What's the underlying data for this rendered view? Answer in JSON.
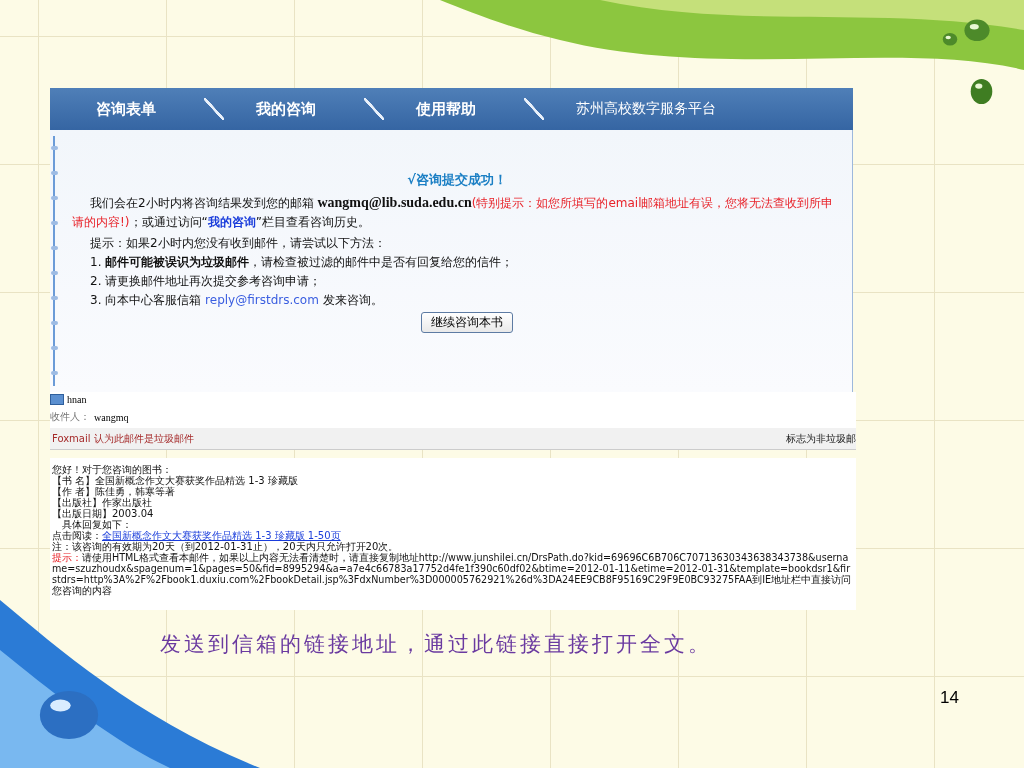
{
  "nav": {
    "items": [
      {
        "label": "咨询表单"
      },
      {
        "label": "我的咨询"
      },
      {
        "label": "使用帮助"
      }
    ],
    "platform": "苏州高校数字服务平台"
  },
  "result": {
    "title": "√咨询提交成功！",
    "notice": [
      {
        "kind": "text",
        "text": "我们会在2小时内将咨询结果发到您的邮箱 "
      },
      {
        "kind": "email",
        "text": "wangmq@lib.suda.edu.cn"
      },
      {
        "kind": "warning",
        "text": "(特别提示：如您所填写的email邮箱地址有误，您将无法查收到所申请的内容!)"
      },
      {
        "kind": "text",
        "text": "；或通过访问“"
      },
      {
        "kind": "link",
        "text": "我的咨询"
      },
      {
        "kind": "text",
        "text": "”栏目查看咨询历史。"
      }
    ],
    "hint": "提示：如果2小时内您没有收到邮件，请尝试以下方法：",
    "steps": [
      [
        {
          "kind": "text",
          "text": "1. "
        },
        {
          "kind": "bold",
          "text": "邮件可能被误识为垃圾邮件"
        },
        {
          "kind": "text",
          "text": "，请检查被过滤的邮件中是否有回复给您的信件；"
        }
      ],
      [
        {
          "kind": "text",
          "text": "2. 请更换邮件地址再次提交参考咨询申请；"
        }
      ],
      [
        {
          "kind": "text",
          "text": "3. 向本中心客服信箱 "
        },
        {
          "kind": "mail",
          "text": "reply@firstdrs.com"
        },
        {
          "kind": "text",
          "text": " 发来咨询。"
        }
      ]
    ],
    "button": "继续咨询本书"
  },
  "email": {
    "sender": "hnan",
    "recipient_label": "收件人：",
    "recipient": "wangmq",
    "spam_notice": "Foxmail 认为此邮件是垃圾邮件",
    "spam_action": "标志为非垃圾邮",
    "body": [
      {
        "kind": "text",
        "text": "您好！对于您咨询的图书："
      },
      {
        "kind": "text",
        "text": "【书 名】全国新概念作文大赛获奖作品精选 1-3 珍藏版"
      },
      {
        "kind": "text",
        "text": "【作 者】陈佳勇，韩寒等著"
      },
      {
        "kind": "text",
        "text": "【出版社】作家出版社"
      },
      {
        "kind": "text",
        "text": "【出版日期】2003.04"
      },
      {
        "kind": "indent",
        "text": "具体回复如下："
      },
      {
        "kind": "link",
        "label": "点击阅读：",
        "text": "全国新概念作文大赛获奖作品精选 1-3 珍藏版  1-50页"
      },
      {
        "kind": "text",
        "text": "注：该咨询的有效期为20天（到2012-01-31止），20天内只允许打开20次。"
      },
      {
        "kind": "tip",
        "label": "提示：",
        "text": "请使用HTML格式查看本邮件，如果以上内容无法看清楚时，请直接复制地址http://www.junshilei.cn/DrsPath.do?kid=69696C6B706C70713630343638343738&username=szuzhoudx&spagenum=1&pages=50&fid=8995294&a=a7e4c66783a17752d4fe1f390c60df02&btime=2012-01-11&etime=2012-01-31&template=bookdsr1&firstdrs=http%3A%2F%2Fbook1.duxiu.com%2FbookDetail.jsp%3FdxNumber%3D000005762921%26d%3DA24EE9CB8F95169C29F9E0BC93275FAA到IE地址栏中直接访问您咨询的内容"
      }
    ]
  },
  "caption": "发送到信箱的链接地址，通过此链接直接打开全文。",
  "page_number": "14"
}
